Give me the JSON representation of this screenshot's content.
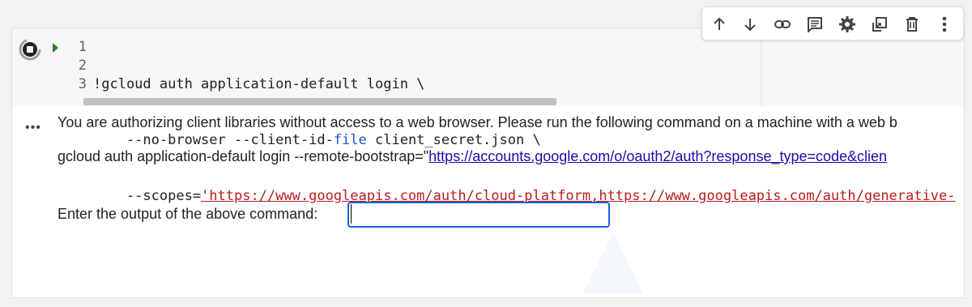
{
  "toolbar": {
    "buttons": [
      {
        "icon": "arrow-up-icon",
        "name": "move-cell-up"
      },
      {
        "icon": "arrow-down-icon",
        "name": "move-cell-down"
      },
      {
        "icon": "link-icon",
        "name": "copy-link"
      },
      {
        "icon": "comment-icon",
        "name": "add-comment"
      },
      {
        "icon": "gear-icon",
        "name": "cell-settings"
      },
      {
        "icon": "mirror-cell-icon",
        "name": "mirror-cell"
      },
      {
        "icon": "trash-icon",
        "name": "delete-cell"
      },
      {
        "icon": "more-vert-icon",
        "name": "more-actions"
      }
    ]
  },
  "cell": {
    "line_numbers": [
      "1",
      "2",
      "3"
    ],
    "code": {
      "line1": "!gcloud auth application-default login \\",
      "line2_indent": "    --no-browser --client-id-",
      "line2_file": "file",
      "line2_rest": " client_secret.json \\",
      "line3_prefix": "    --scopes=",
      "line3_string": "'https://www.googleapis.com/auth/cloud-platform,https://www.googleapis.com/auth/generative-"
    },
    "run_button_state": "running",
    "colors": {
      "keyword_file": "#1a55c7",
      "string": "#b71c1c",
      "input_border": "#1a5fd6",
      "link": "#1a0dab"
    }
  },
  "output": {
    "dots": "•••",
    "message": "You are authorizing client libraries without access to a web browser. Please run the following command on a machine with a web b",
    "command_prefix": "gcloud auth application-default login --remote-bootstrap=\"",
    "command_link": "https://accounts.google.com/o/oauth2/auth?response_type=code&clien",
    "prompt_label": "Enter the output of the above command:",
    "prompt_value": ""
  }
}
